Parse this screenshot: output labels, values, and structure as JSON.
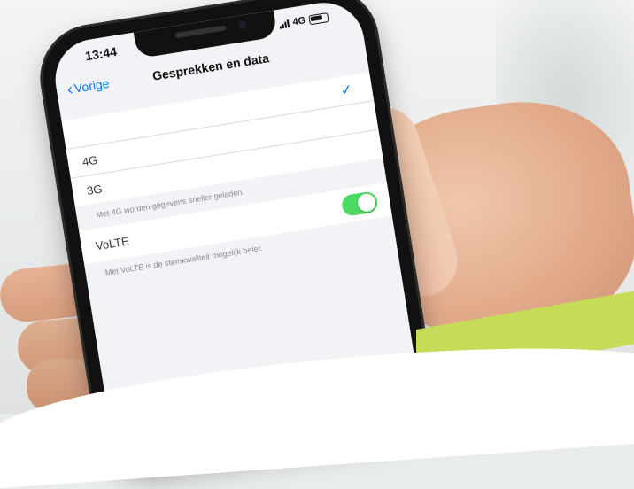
{
  "status_bar": {
    "time": "13:44",
    "network": "4G"
  },
  "navbar": {
    "back_label": "Vorige",
    "title": "Gesprekken en data"
  },
  "network_options": {
    "rows": [
      {
        "label": "",
        "selected": true
      },
      {
        "label": "4G",
        "selected": false
      },
      {
        "label": "3G",
        "selected": false
      }
    ],
    "footnote": "Met 4G worden gegevens sneller geladen."
  },
  "volte": {
    "label": "VoLTE",
    "enabled": true,
    "footnote": "Met VoLTE is de stemkwaliteit mogelijk beter."
  },
  "colors": {
    "accent_green": "#c6dc58",
    "ios_blue": "#007aff",
    "toggle_on": "#4cd964"
  }
}
